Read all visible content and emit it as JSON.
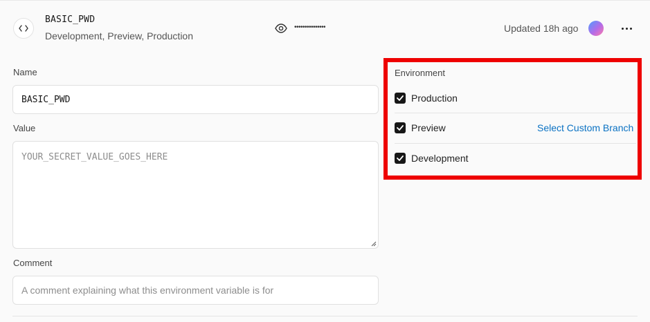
{
  "header": {
    "variable_name": "BASIC_PWD",
    "environments_summary": "Development, Preview, Production",
    "masked_value": "•••••••••••••••",
    "updated_text": "Updated 18h ago",
    "icons": {
      "code": "code-brackets-icon",
      "reveal": "eye-icon",
      "menu": "more-horizontal-icon"
    }
  },
  "form": {
    "name_label": "Name",
    "name_value": "BASIC_PWD",
    "value_label": "Value",
    "value_placeholder": "YOUR_SECRET_VALUE_GOES_HERE",
    "comment_label": "Comment",
    "comment_placeholder": "A comment explaining what this environment variable is for"
  },
  "environment": {
    "title": "Environment",
    "options": [
      {
        "label": "Production",
        "checked": true
      },
      {
        "label": "Preview",
        "checked": true
      },
      {
        "label": "Development",
        "checked": true
      }
    ],
    "custom_branch_link": "Select Custom Branch"
  },
  "colors": {
    "highlight_border": "#ee0000",
    "link": "#0b72c3",
    "checkbox": "#171717"
  }
}
